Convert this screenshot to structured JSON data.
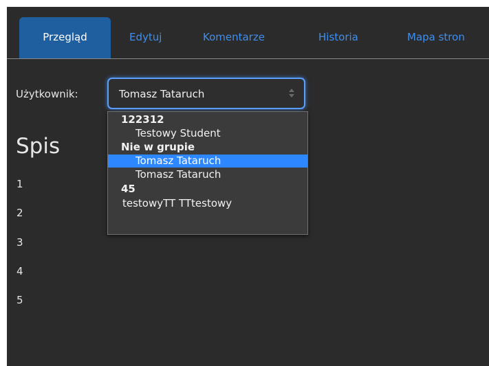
{
  "tabs": [
    {
      "label": "Przegląd",
      "active": true
    },
    {
      "label": "Edytuj",
      "active": false
    },
    {
      "label": "Komentarze",
      "active": false
    },
    {
      "label": "Historia",
      "active": false
    },
    {
      "label": "Mapa stron",
      "active": false
    }
  ],
  "user_filter": {
    "label": "Użytkownik:",
    "selected": "Tomasz Tataruch"
  },
  "dropdown": {
    "groups": [
      {
        "label": "122312",
        "options": [
          "Testowy Student"
        ]
      },
      {
        "label": "Nie w grupie",
        "options": [
          "Tomasz Tataruch",
          "Tomasz Tataruch"
        ]
      },
      {
        "label": "45",
        "options": [
          "testowyTT TTtestowy"
        ]
      }
    ],
    "highlighted_option": "Tomasz Tataruch"
  },
  "content": {
    "heading": "Spis",
    "items": [
      "1",
      "2",
      "3",
      "4",
      "5"
    ]
  },
  "colors": {
    "background": "#2b2b2b",
    "active_tab": "#1f5fa0",
    "link": "#3d8ff0",
    "highlight": "#2d88ff",
    "focus_ring": "#5aa0ff"
  },
  "icons": {
    "select_arrow": "updown-chevron-icon"
  }
}
